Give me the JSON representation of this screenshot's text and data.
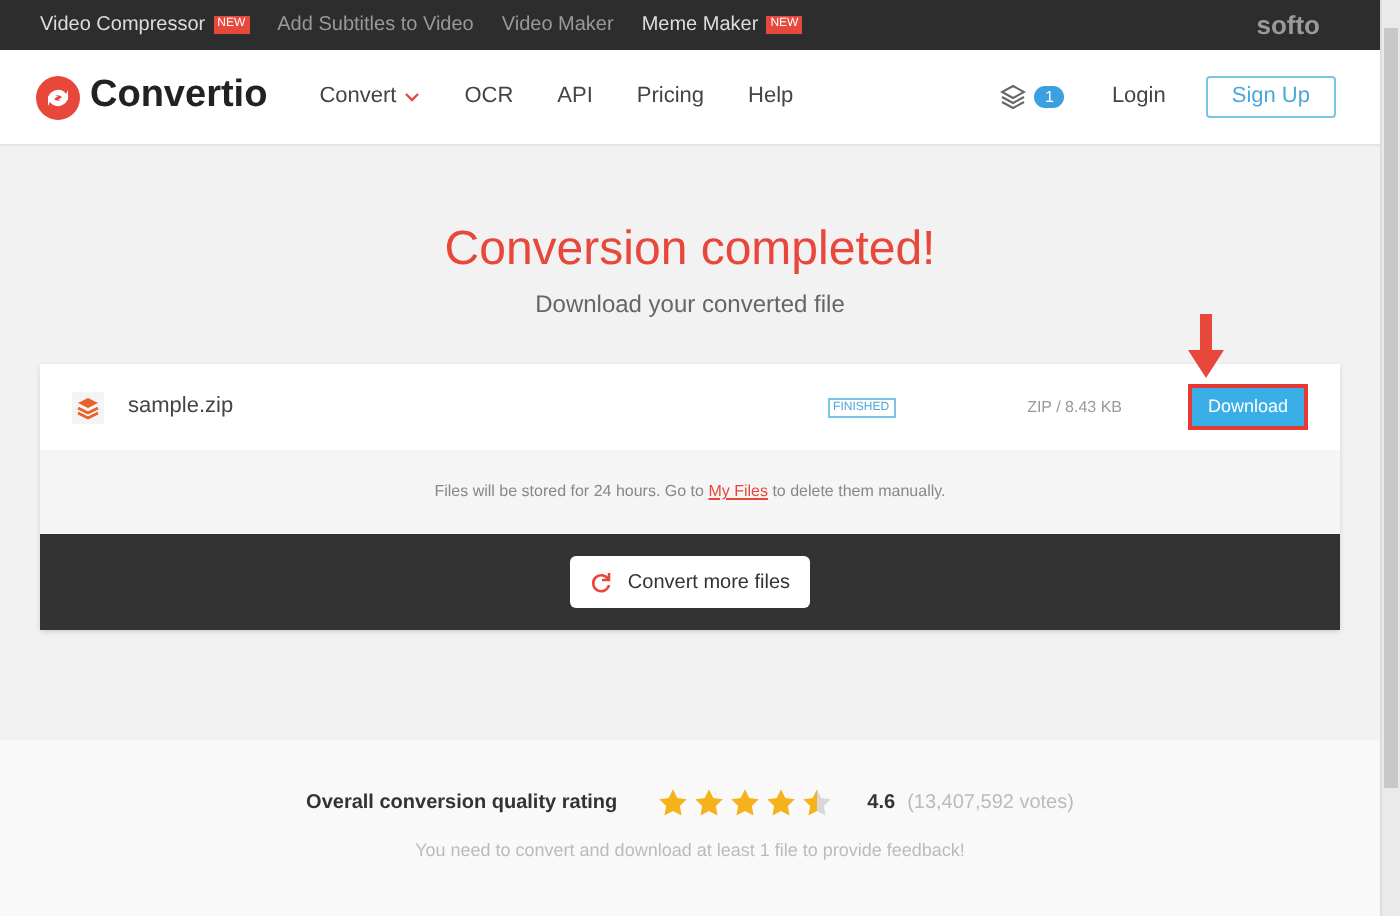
{
  "promo_bar": {
    "links": [
      {
        "label": "Video Compressor",
        "badge": "NEW"
      },
      {
        "label": "Add Subtitles to Video"
      },
      {
        "label": "Video Maker"
      },
      {
        "label": "Meme Maker",
        "badge": "NEW"
      }
    ],
    "brand": "softo"
  },
  "nav": {
    "logo": "Convertio",
    "items": [
      {
        "label": "Convert",
        "dropdown": true
      },
      {
        "label": "OCR",
        "dropdown": false
      },
      {
        "label": "API",
        "dropdown": false
      },
      {
        "label": "Pricing",
        "dropdown": false
      },
      {
        "label": "Help",
        "dropdown": false
      }
    ],
    "files_count": "1",
    "login": "Login",
    "signup": "Sign Up"
  },
  "heading": "Conversion completed!",
  "subheading": "Download your converted file",
  "file": {
    "name": "sample.zip",
    "status": "FINISHED",
    "info": "ZIP / 8.43 KB",
    "action": "Download",
    "highlighted": true
  },
  "storage_note": {
    "before": "Files will be stored for 24 hours. Go to",
    "link": "My Files",
    "after": "to delete them manually."
  },
  "convert_more": "Convert more files",
  "rating": {
    "label": "Overall conversion quality rating",
    "stars": 4.5,
    "score": "4.6",
    "votes": "(13,407,592 votes)",
    "note": "You need to convert and download at least 1 file to provide feedback!"
  }
}
